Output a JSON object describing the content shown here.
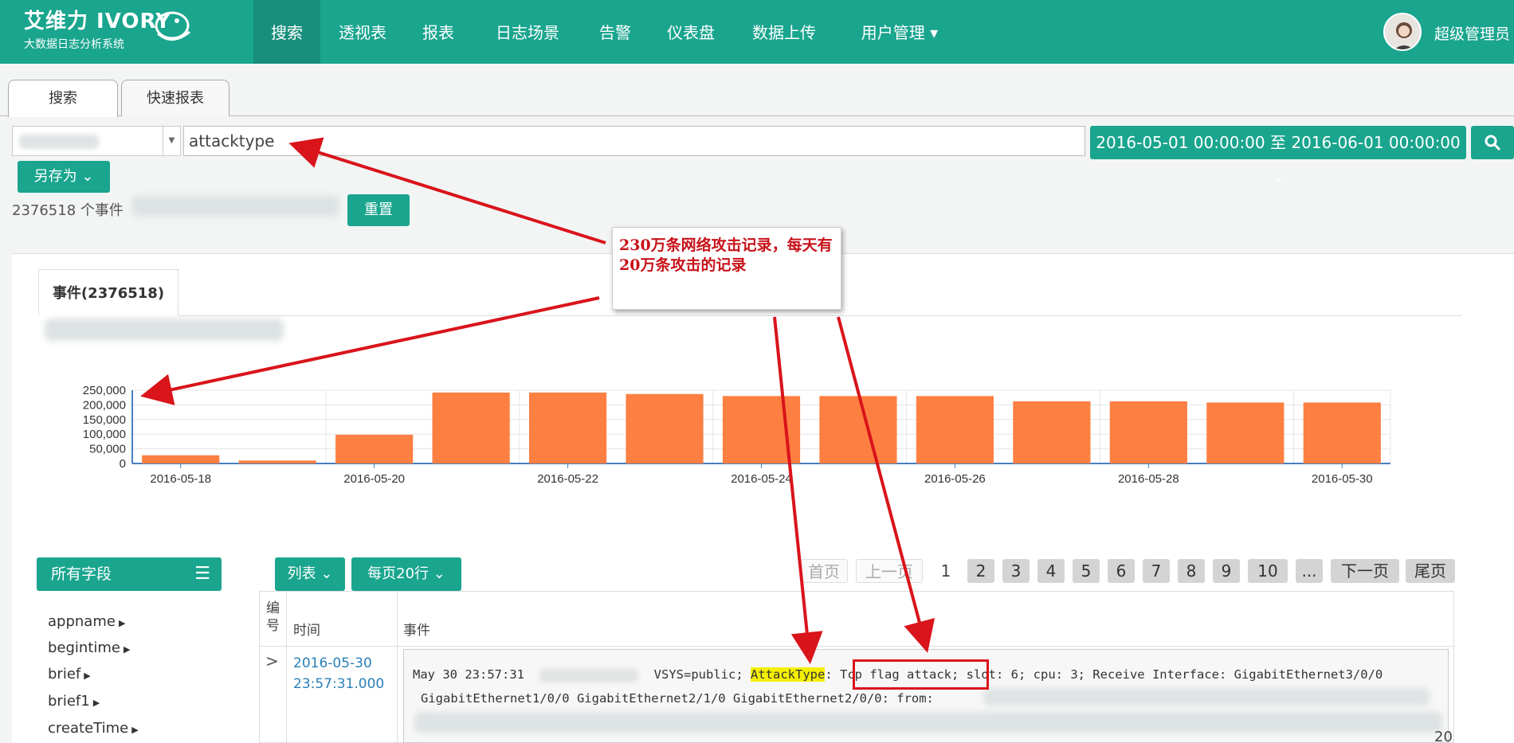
{
  "brand": {
    "name": "艾维力 IVORY",
    "subtitle": "大数据日志分析系统"
  },
  "nav": {
    "items": [
      "搜索",
      "透视表",
      "报表",
      "日志场景",
      "告警",
      "仪表盘",
      "数据上传",
      "用户管理 ▾"
    ],
    "active_index": 0,
    "user": "超级管理员"
  },
  "tabs": [
    "搜索",
    "快速报表"
  ],
  "search": {
    "query": "attacktype",
    "date_range": "2016-05-01 00:00:00 至 2016-06-01 00:00:00 ⌄",
    "save_as": "另存为 ⌄",
    "event_count": "2376518 个事件",
    "reset": "重置"
  },
  "events_tab": "事件(2376518)",
  "annotation": {
    "text": "230万条网络攻击记录，每天有20万条攻击的记录"
  },
  "chart_data": {
    "type": "bar",
    "categories": [
      "2016-05-18",
      "2016-05-19",
      "2016-05-20",
      "2016-05-21",
      "2016-05-22",
      "2016-05-23",
      "2016-05-24",
      "2016-05-25",
      "2016-05-26",
      "2016-05-27",
      "2016-05-28",
      "2016-05-29",
      "2016-05-30"
    ],
    "x_tick_labels": [
      "2016-05-18",
      "2016-05-20",
      "2016-05-22",
      "2016-05-24",
      "2016-05-26",
      "2016-05-28",
      "2016-05-30"
    ],
    "values": [
      28000,
      10000,
      98000,
      242000,
      242000,
      237000,
      230000,
      230000,
      230000,
      212000,
      212000,
      208000,
      208000
    ],
    "y_ticks": [
      "250,000",
      "200,000",
      "150,000",
      "100,000",
      "50,000",
      "0"
    ],
    "ylim": [
      0,
      250000
    ],
    "bar_color": "#fd7f42",
    "grid": true
  },
  "fields": {
    "header": "所有字段",
    "items": [
      "appname",
      "begintime",
      "brief",
      "brief1",
      "createTime"
    ]
  },
  "list_controls": {
    "list": "列表 ⌄",
    "per_page": "每页20行 ⌄"
  },
  "pagination": [
    "首页",
    "上一页",
    "1",
    "2",
    "3",
    "4",
    "5",
    "6",
    "7",
    "8",
    "9",
    "10",
    "...",
    "下一页",
    "尾页"
  ],
  "table": {
    "headers": {
      "num": "编号",
      "time": "时间",
      "event": "事件"
    },
    "rows": [
      {
        "time_date": "2016-05-30",
        "time_clock": "23:57:31.000",
        "line1_a": "May 30 23:57:31",
        "line1_b": "VSYS=public;",
        "line1_hl": "AttackType",
        "line1_c": ":",
        "line1_d": "Tcp flag attack;",
        "line1_e": "slot: 6; cpu: 3; Receive Interface: GigabitEthernet3/0/0",
        "line2": "GigabitEthernet1/0/0 GigabitEthernet2/1/0 GigabitEthernet2/0/0: from:"
      }
    ]
  },
  "corner_number": "20"
}
